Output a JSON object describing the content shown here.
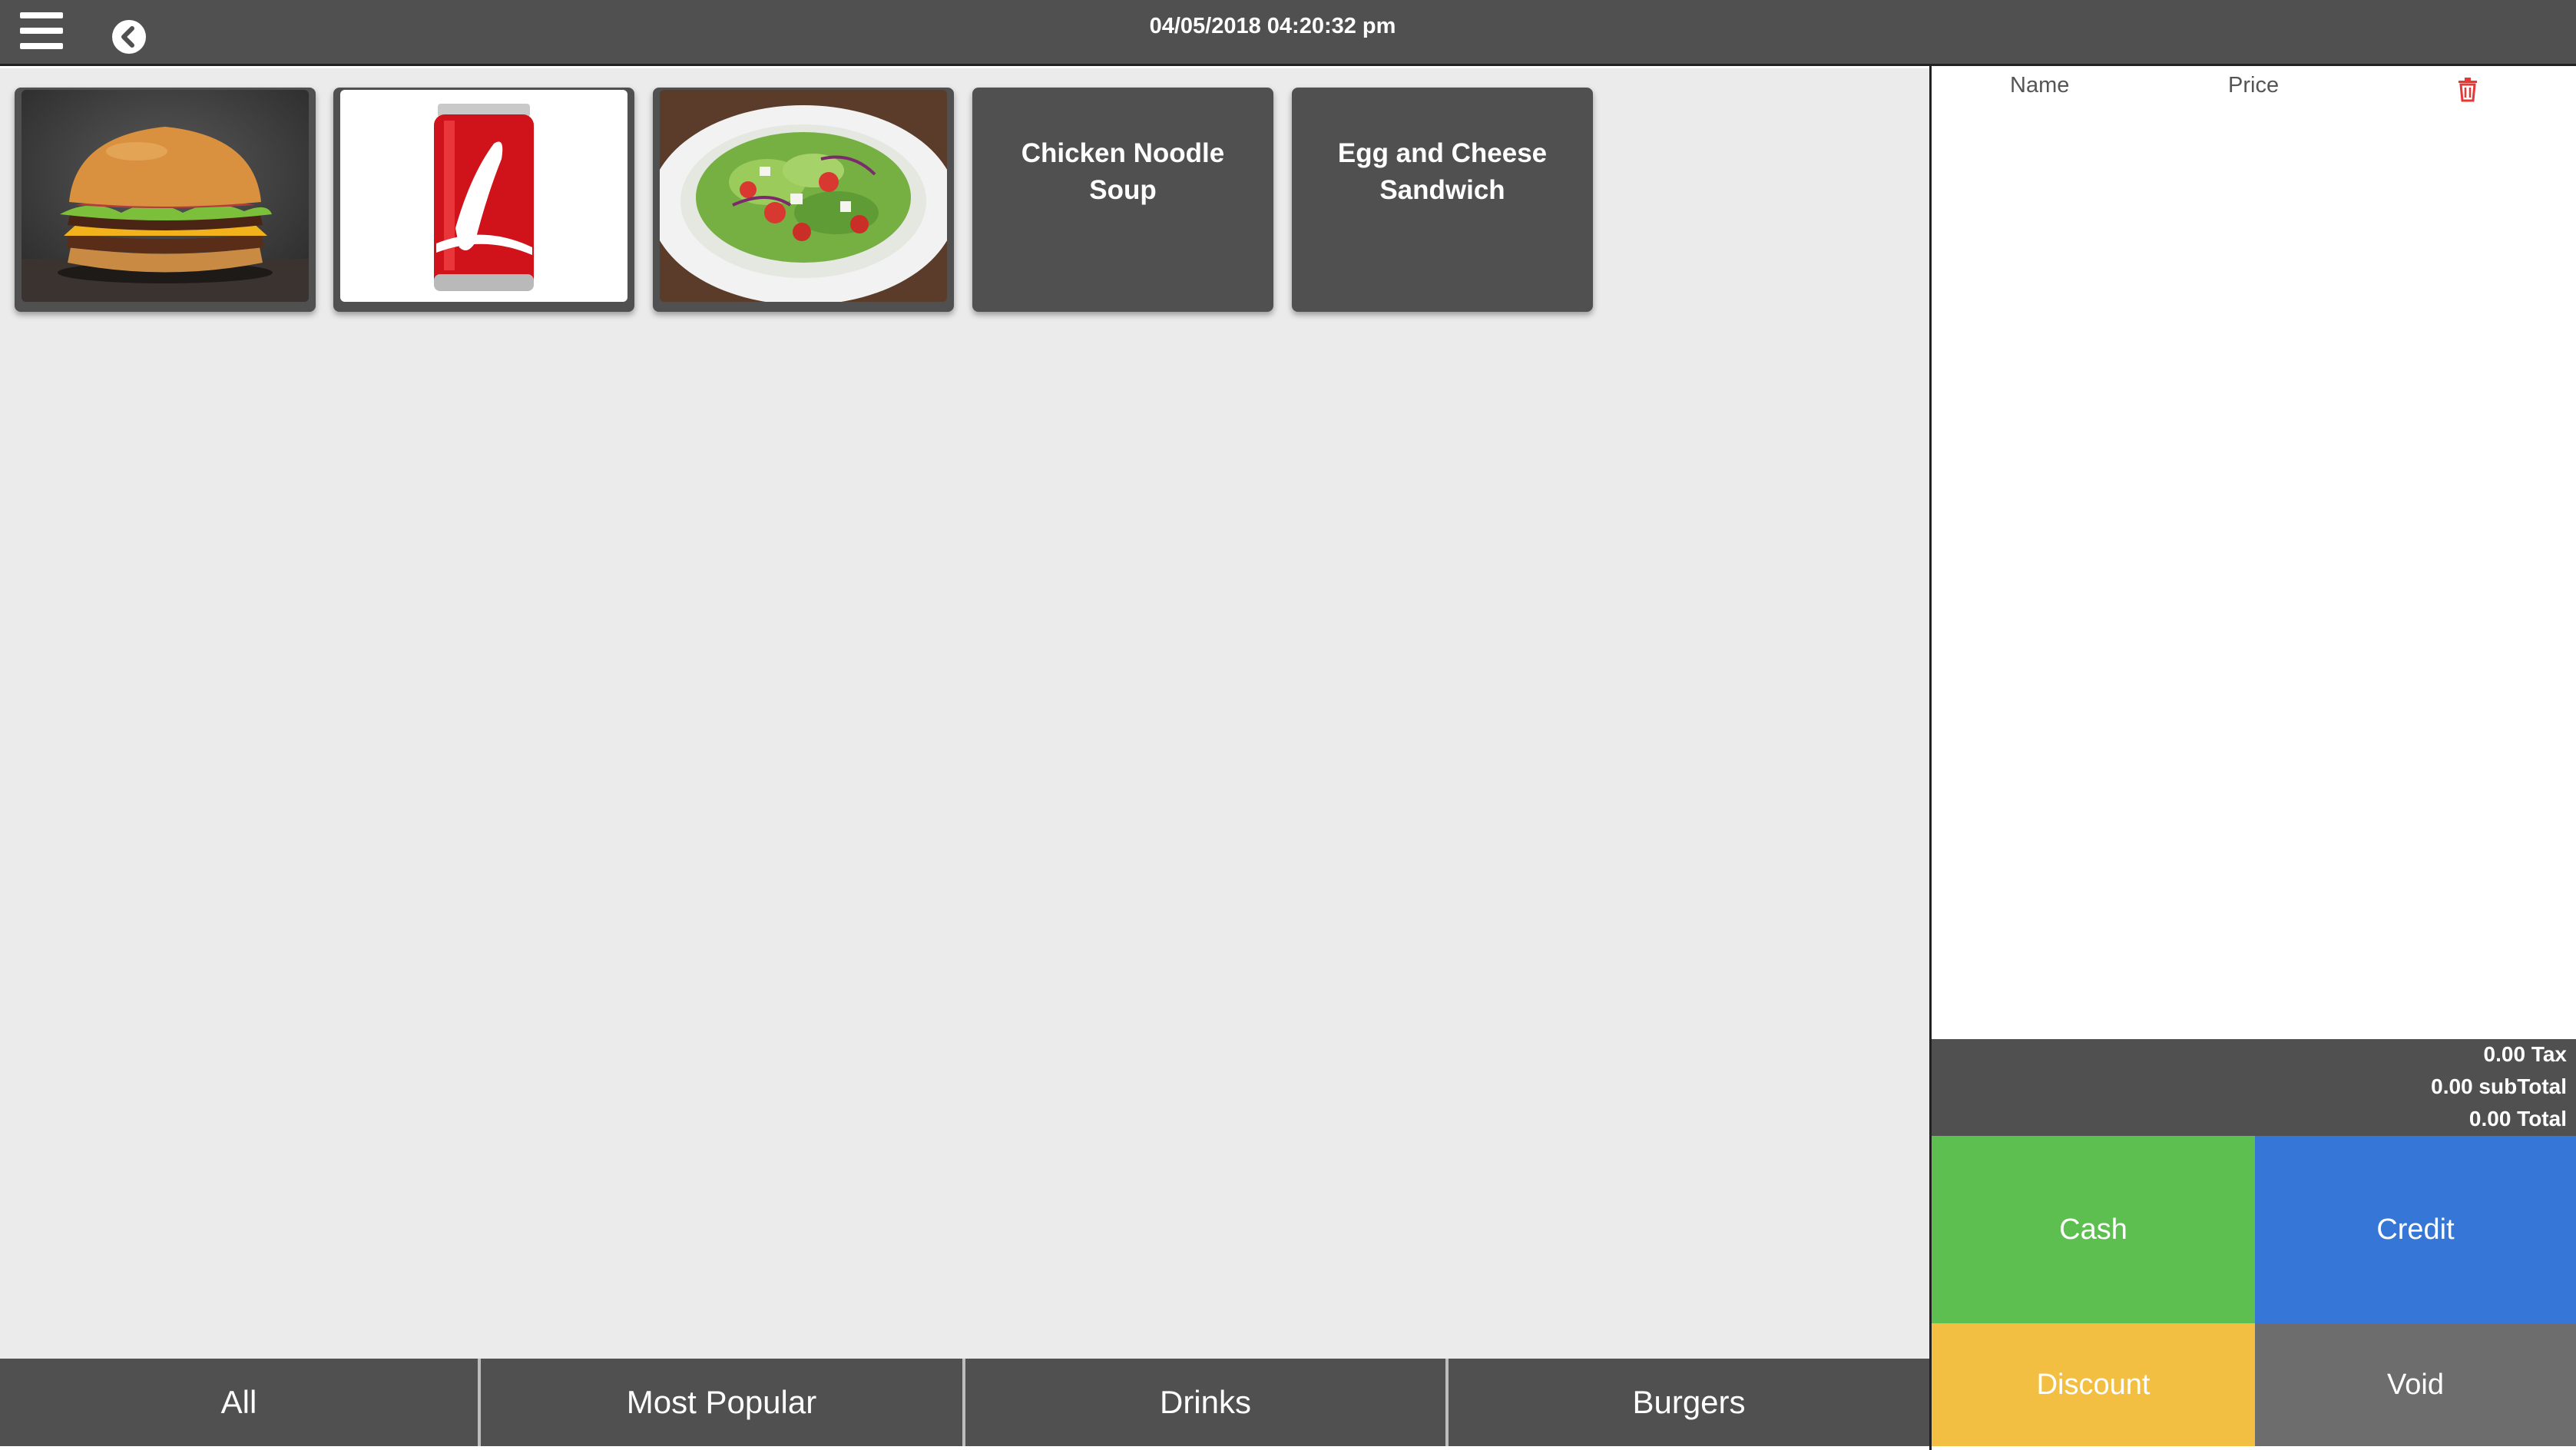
{
  "header": {
    "datetime": "04/05/2018 04:20:32 pm"
  },
  "products": [
    {
      "name": "",
      "image": "burger"
    },
    {
      "name": "",
      "image": "cola-can"
    },
    {
      "name": "",
      "image": "salad"
    },
    {
      "name": "Chicken Noodle Soup",
      "image": ""
    },
    {
      "name": "Egg and Cheese Sandwich",
      "image": ""
    }
  ],
  "categories": [
    "All",
    "Most Popular",
    "Drinks",
    "Burgers"
  ],
  "order": {
    "columns": {
      "name": "Name",
      "price": "Price"
    },
    "items": []
  },
  "totals": {
    "tax": "0.00 Tax",
    "subtotal": "0.00 subTotal",
    "total": "0.00 Total"
  },
  "actions": {
    "cash": "Cash",
    "credit": "Credit",
    "discount": "Discount",
    "void": "Void"
  },
  "colors": {
    "bar": "#505050",
    "cash": "#5cbf4f",
    "credit": "#3576d7",
    "discount": "#f3bf42",
    "void": "#6d6d6d",
    "trash": "#e53935"
  }
}
